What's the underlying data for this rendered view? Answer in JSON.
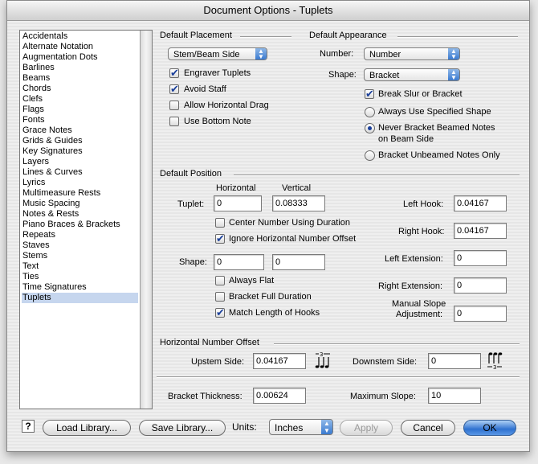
{
  "window": {
    "title": "Document Options - Tuplets"
  },
  "sidebar": {
    "items": [
      {
        "label": "Accidentals"
      },
      {
        "label": "Alternate Notation"
      },
      {
        "label": "Augmentation Dots"
      },
      {
        "label": "Barlines"
      },
      {
        "label": "Beams"
      },
      {
        "label": "Chords"
      },
      {
        "label": "Clefs"
      },
      {
        "label": "Flags"
      },
      {
        "label": "Fonts"
      },
      {
        "label": "Grace Notes"
      },
      {
        "label": "Grids & Guides"
      },
      {
        "label": "Key Signatures"
      },
      {
        "label": "Layers"
      },
      {
        "label": "Lines & Curves"
      },
      {
        "label": "Lyrics"
      },
      {
        "label": "Multimeasure Rests"
      },
      {
        "label": "Music Spacing"
      },
      {
        "label": "Notes & Rests"
      },
      {
        "label": "Piano Braces & Brackets"
      },
      {
        "label": "Repeats"
      },
      {
        "label": "Staves"
      },
      {
        "label": "Stems"
      },
      {
        "label": "Text"
      },
      {
        "label": "Ties"
      },
      {
        "label": "Time Signatures"
      },
      {
        "label": "Tuplets"
      }
    ],
    "selected": "Tuplets"
  },
  "default_placement": {
    "heading": "Default Placement",
    "placement_select": "Stem/Beam Side",
    "engraver_tuplets": {
      "label": "Engraver Tuplets",
      "checked": true
    },
    "avoid_staff": {
      "label": "Avoid Staff",
      "checked": true
    },
    "allow_horizontal_drag": {
      "label": "Allow Horizontal Drag",
      "checked": false
    },
    "use_bottom_note": {
      "label": "Use Bottom Note",
      "checked": false
    }
  },
  "default_appearance": {
    "heading": "Default Appearance",
    "number_label": "Number:",
    "number_value": "Number",
    "shape_label": "Shape:",
    "shape_value": "Bracket",
    "break_slur": {
      "label": "Break Slur or Bracket",
      "checked": true
    },
    "radio_always": {
      "label": "Always Use Specified Shape",
      "selected": false
    },
    "radio_never_line1": "Never Bracket Beamed Notes",
    "radio_never_line2": "on Beam Side",
    "radio_never_selected": true,
    "radio_unbeamed": {
      "label": "Bracket Unbeamed Notes Only",
      "selected": false
    }
  },
  "default_position": {
    "heading": "Default Position",
    "horizontal_header": "Horizontal",
    "vertical_header": "Vertical",
    "tuplet_label": "Tuplet:",
    "tuplet_h": "0",
    "tuplet_v": "0.08333",
    "center_number": {
      "label": "Center Number Using Duration",
      "checked": false
    },
    "ignore_offset": {
      "label": "Ignore Horizontal Number Offset",
      "checked": true
    },
    "shape_label": "Shape:",
    "shape_h": "0",
    "shape_v": "0",
    "always_flat": {
      "label": "Always Flat",
      "checked": false
    },
    "bracket_full": {
      "label": "Bracket Full Duration",
      "checked": false
    },
    "match_hooks": {
      "label": "Match Length of Hooks",
      "checked": true
    },
    "left_hook_label": "Left Hook:",
    "left_hook": "0.04167",
    "right_hook_label": "Right Hook:",
    "right_hook": "0.04167",
    "left_ext_label": "Left Extension:",
    "left_ext": "0",
    "right_ext_label": "Right Extension:",
    "right_ext": "0",
    "manual_slope_line1": "Manual Slope",
    "manual_slope_line2": "Adjustment:",
    "manual_slope": "0"
  },
  "horizontal_number_offset": {
    "heading": "Horizontal Number Offset",
    "upstem_label": "Upstem Side:",
    "upstem": "0.04167",
    "downstem_label": "Downstem Side:",
    "downstem": "0"
  },
  "bracket": {
    "thickness_label": "Bracket Thickness:",
    "thickness": "0.00624",
    "max_slope_label": "Maximum Slope:",
    "max_slope": "10"
  },
  "footer": {
    "help": "?",
    "load_library": "Load Library...",
    "save_library": "Save Library...",
    "units_label": "Units:",
    "units_value": "Inches",
    "apply": "Apply",
    "cancel": "Cancel",
    "ok": "OK"
  },
  "icons": {
    "upstem_tuplet": "upstem-tuplet-icon",
    "downstem_tuplet": "downstem-tuplet-icon"
  }
}
